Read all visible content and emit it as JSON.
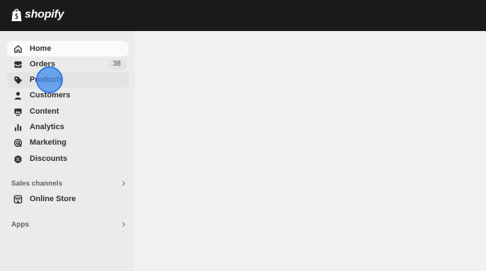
{
  "brand": {
    "name": "shopify"
  },
  "nav": {
    "items": [
      {
        "label": "Home",
        "icon": "home-icon"
      },
      {
        "label": "Orders",
        "icon": "inbox-icon",
        "badge": "38"
      },
      {
        "label": "Products",
        "icon": "tag-icon"
      },
      {
        "label": "Customers",
        "icon": "person-icon"
      },
      {
        "label": "Content",
        "icon": "image-icon"
      },
      {
        "label": "Analytics",
        "icon": "bar-chart-icon"
      },
      {
        "label": "Marketing",
        "icon": "target-icon"
      },
      {
        "label": "Discounts",
        "icon": "discount-icon"
      }
    ]
  },
  "sales_channels": {
    "label": "Sales channels",
    "items": [
      {
        "label": "Online Store",
        "icon": "store-icon"
      }
    ]
  },
  "apps": {
    "label": "Apps"
  },
  "colors": {
    "topbar": "#1a1a1a",
    "sidebar": "#ebebeb",
    "main": "#f1f1f1",
    "cursor": "#2f7be0"
  }
}
